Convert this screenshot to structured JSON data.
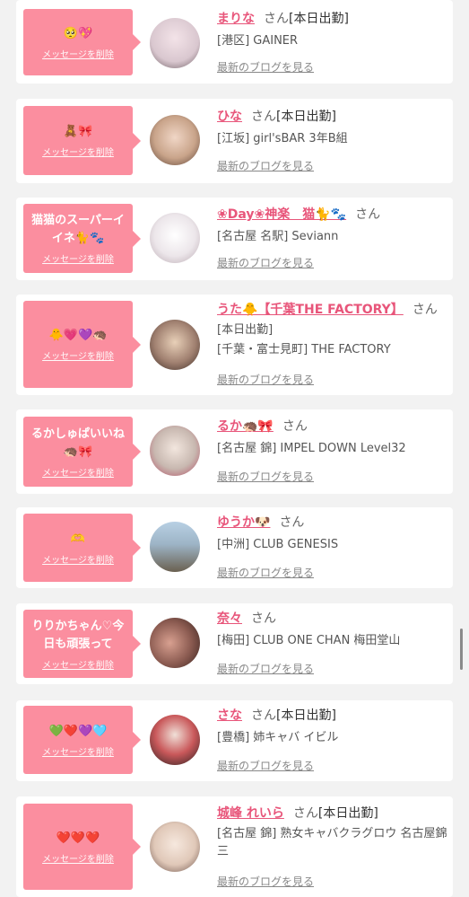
{
  "delete_label": "メッセージを削除",
  "blog_label": "最新のブログを見る",
  "san_label": "さん",
  "accent_color": "#fb8e9f",
  "name_color": "#e8557a",
  "cards": [
    {
      "bubble": "🥺💖",
      "name": "まりな",
      "status": "[本日出勤]",
      "shop": "[港区] GAINER"
    },
    {
      "bubble": "🧸🎀",
      "name": "ひな",
      "status": "[本日出勤]",
      "shop": "[江坂] girl'sBAR 3年B組"
    },
    {
      "bubble": "猫猫のスーパーイイネ🐈🐾",
      "name": "❀Day❀神楽　猫🐈🐾",
      "status": "",
      "shop": "[名古屋 名駅] Seviann"
    },
    {
      "bubble": "🐥💗💜🦔",
      "name": "うた🐥【千葉THE FACTORY】",
      "status": "[本日出勤]",
      "shop": "[千葉・富士見町] THE FACTORY"
    },
    {
      "bubble": "るかしゅぱいいね🦔🎀",
      "name": "るか🦔🎀",
      "status": "",
      "shop": "[名古屋 錦] IMPEL DOWN Level32"
    },
    {
      "bubble": "🫶",
      "name": "ゆうか🐶",
      "status": "",
      "shop": "[中洲] CLUB GENESIS"
    },
    {
      "bubble": "りりかちゃん♡今日も頑張って",
      "name": "奈々",
      "status": "",
      "shop": "[梅田] CLUB ONE CHAN 梅田堂山"
    },
    {
      "bubble": "💚❤️💜🩵",
      "name": "さな",
      "status": "[本日出勤]",
      "shop": "[豊橋] 姉キャバ イビル"
    },
    {
      "bubble": "❤️❤️❤️",
      "name": "城峰 れいら",
      "status": "[本日出勤]",
      "shop": "[名古屋 錦] 熟女キャバクラグロウ 名古屋錦三"
    }
  ],
  "avatars": [
    {
      "icon": "avatar-photo",
      "color": "#d9c7cf"
    },
    {
      "icon": "avatar-photo",
      "color": "#c9a48a"
    },
    {
      "icon": "avatar-photo",
      "color": "#ece6ea"
    },
    {
      "icon": "avatar-photo",
      "color": "#a08070"
    },
    {
      "icon": "avatar-photo",
      "color": "#c8b8b0"
    },
    {
      "icon": "avatar-photo",
      "color": "#9db4c6"
    },
    {
      "icon": "avatar-photo",
      "color": "#8a5a50"
    },
    {
      "icon": "avatar-photo",
      "color": "#c9585a"
    },
    {
      "icon": "avatar-photo",
      "color": "#e0c8b8"
    }
  ]
}
